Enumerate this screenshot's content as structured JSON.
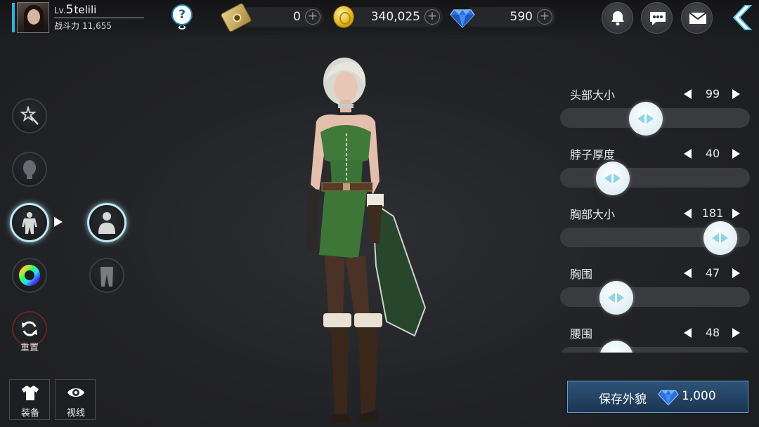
{
  "player": {
    "level_prefix": "Lv.",
    "level": "5",
    "name": "telili",
    "power_label": "战斗力",
    "power_value": "11,655"
  },
  "currencies": {
    "tickets": "0",
    "gold": "340,025",
    "gems": "590"
  },
  "icons": {
    "help": "?",
    "plus": "+"
  },
  "tools": {
    "reset_label": "重置"
  },
  "bottom_buttons": {
    "equip_label": "装备",
    "view_label": "视线"
  },
  "sliders": [
    {
      "label": "头部大小",
      "value": "99",
      "level": 0.44
    },
    {
      "label": "脖子厚度",
      "value": "40",
      "level": 0.23
    },
    {
      "label": "胸部大小",
      "value": "181",
      "level": 0.92
    },
    {
      "label": "胸围",
      "value": "47",
      "level": 0.25
    },
    {
      "label": "腰围",
      "value": "48",
      "level": 0.25
    }
  ],
  "save": {
    "label": "保存外貌",
    "cost": "1,000"
  },
  "colors": {
    "accent": "#29b6d8",
    "save_button": "#2d5478",
    "knob_arrow": "#8fd3e8"
  }
}
